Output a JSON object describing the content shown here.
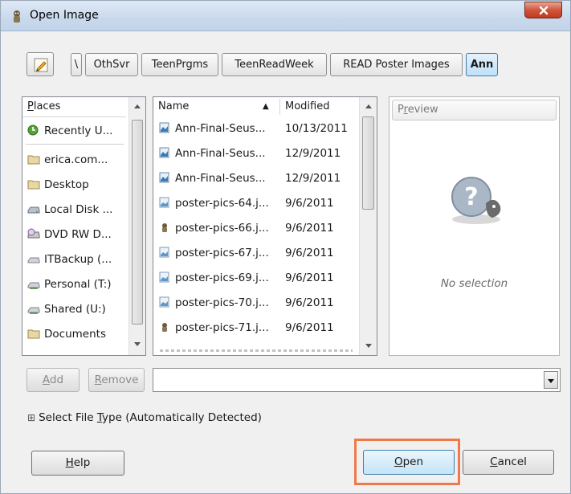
{
  "window": {
    "title": "Open Image",
    "close_label": "x"
  },
  "pathbar": {
    "crumbs": [
      {
        "label": "\\"
      },
      {
        "label": "OthSvr"
      },
      {
        "label": "TeenPrgms"
      },
      {
        "label": "TeenReadWeek"
      },
      {
        "label": "READ Poster Images"
      },
      {
        "label": "Ann",
        "active": true
      }
    ]
  },
  "places": {
    "header_first": "P",
    "header_rest": "laces",
    "items": [
      {
        "label": "Recently U...",
        "icon": "recent-icon"
      },
      {
        "label": "erica.com...",
        "icon": "folder-icon"
      },
      {
        "label": "Desktop",
        "icon": "folder-icon"
      },
      {
        "label": "Local Disk ...",
        "icon": "drive-icon"
      },
      {
        "label": "DVD RW D...",
        "icon": "dvd-icon"
      },
      {
        "label": "ITBackup (...",
        "icon": "network-drive-icon"
      },
      {
        "label": "Personal (T:)",
        "icon": "network-drive-icon"
      },
      {
        "label": "Shared (U:)",
        "icon": "network-drive-icon"
      },
      {
        "label": "Documents",
        "icon": "folder-icon"
      }
    ]
  },
  "files": {
    "col_name": "Name",
    "col_modified": "Modified",
    "sort_indicator": "▲",
    "rows": [
      {
        "name": "Ann-Final-Seus...",
        "modified": "10/13/2011"
      },
      {
        "name": "Ann-Final-Seus...",
        "modified": "12/9/2011"
      },
      {
        "name": "Ann-Final-Seus...",
        "modified": "12/9/2011"
      },
      {
        "name": "poster-pics-64.j...",
        "modified": "9/6/2011"
      },
      {
        "name": "poster-pics-66.j...",
        "modified": "9/6/2011"
      },
      {
        "name": "poster-pics-67.j...",
        "modified": "9/6/2011"
      },
      {
        "name": "poster-pics-69.j...",
        "modified": "9/6/2011"
      },
      {
        "name": "poster-pics-70.j...",
        "modified": "9/6/2011"
      },
      {
        "name": "poster-pics-71.j...",
        "modified": "9/6/2011"
      }
    ]
  },
  "preview": {
    "header_first": "P",
    "header_mid": "r",
    "header_rest": "eview",
    "empty_text": "No selection"
  },
  "bookmarks": {
    "add_first": "A",
    "add_rest": "dd",
    "remove_first": "R",
    "remove_rest": "emove"
  },
  "filetype": {
    "expander": "⊞",
    "label_pre": "Select File ",
    "label_key": "T",
    "label_post": "ype (Automatically Detected)"
  },
  "buttons": {
    "help_first": "H",
    "help_rest": "elp",
    "open_first": "O",
    "open_rest": "pen",
    "cancel_first": "C",
    "cancel_rest": "ancel"
  },
  "colors": {
    "accent": "#3c7fb1",
    "highlight": "#ee7a4b",
    "close": "#c1381b"
  }
}
